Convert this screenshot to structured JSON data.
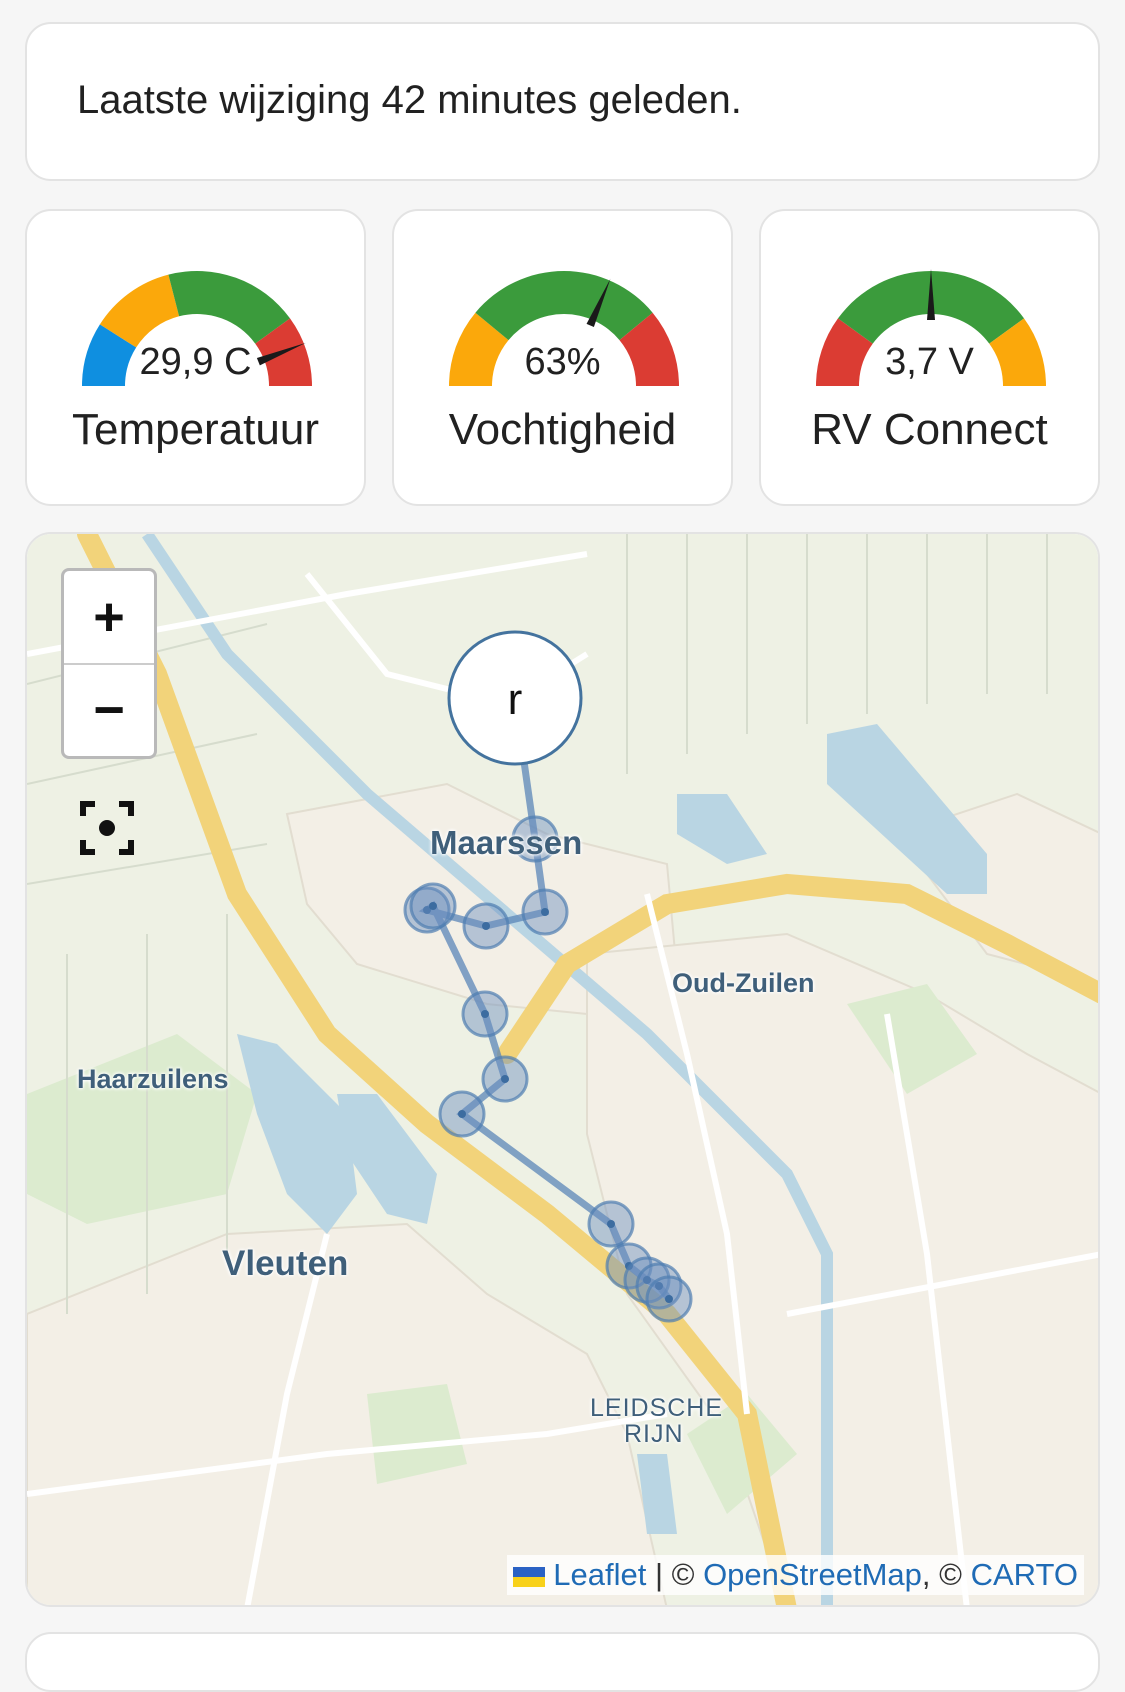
{
  "status": {
    "text": "Laatste wijziging 42 minutes geleden."
  },
  "gauges": [
    {
      "value": "29,9 C",
      "name": "Temperatuur",
      "needle_fraction": 0.88,
      "segments": [
        {
          "from": 0.0,
          "to": 0.18,
          "color": "#0f8fe0"
        },
        {
          "from": 0.18,
          "to": 0.42,
          "color": "#fba80b"
        },
        {
          "from": 0.42,
          "to": 0.8,
          "color": "#3b9b3c"
        },
        {
          "from": 0.8,
          "to": 1.0,
          "color": "#db3c33"
        }
      ]
    },
    {
      "value": "63%",
      "name": "Vochtigheid",
      "needle_fraction": 0.63,
      "segments": [
        {
          "from": 0.0,
          "to": 0.22,
          "color": "#fba80b"
        },
        {
          "from": 0.22,
          "to": 0.78,
          "color": "#3b9b3c"
        },
        {
          "from": 0.78,
          "to": 1.0,
          "color": "#db3c33"
        }
      ]
    },
    {
      "value": "3,7 V",
      "name": "RV Connect",
      "needle_fraction": 0.5,
      "segments": [
        {
          "from": 0.0,
          "to": 0.2,
          "color": "#db3c33"
        },
        {
          "from": 0.2,
          "to": 0.8,
          "color": "#3b9b3c"
        },
        {
          "from": 0.8,
          "to": 1.0,
          "color": "#fba80b"
        }
      ]
    }
  ],
  "map": {
    "zoom_in": "+",
    "zoom_out": "−",
    "marker_label": "r",
    "places": {
      "maarssen": "Maarssen",
      "oud_zuilen": "Oud-Zuilen",
      "haarzuilens": "Haarzuilens",
      "vleuten": "Vleuten",
      "leidsche_rijn_1": "LEIDSCHE",
      "leidsche_rijn_2": "RIJN"
    },
    "attribution": {
      "leaflet": "Leaflet",
      "sep": " | © ",
      "osm": "OpenStreetMap",
      "sep2": ", © ",
      "carto": "CARTO"
    },
    "colors": {
      "track": "#4f7db0",
      "land": "#eef1e4",
      "water": "#b9d5e3",
      "highway": "#f2d37a"
    }
  }
}
